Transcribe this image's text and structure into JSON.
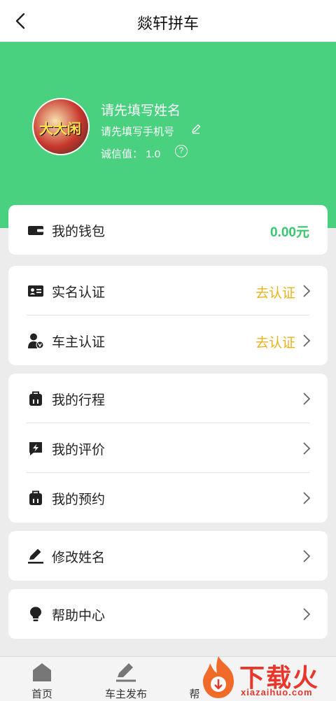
{
  "header": {
    "title": "燚轩拼车",
    "back_icon": "back-chevron-icon"
  },
  "profile": {
    "name": "请先填写姓名",
    "phone": "请先填写手机号",
    "credit_label": "诚信值：",
    "credit_value": "1.0",
    "help_glyph": "?",
    "avatar_text": "大大闲"
  },
  "wallet": {
    "label": "我的钱包",
    "amount": "0.00元",
    "icon": "wallet-icon"
  },
  "verify": [
    {
      "label": "实名认证",
      "status": "去认证",
      "icon": "id-card-icon"
    },
    {
      "label": "车主认证",
      "status": "去认证",
      "icon": "driver-verify-icon"
    }
  ],
  "menu": [
    {
      "label": "我的行程",
      "icon": "luggage-icon"
    },
    {
      "label": "我的评价",
      "icon": "lightning-chat-icon"
    },
    {
      "label": "我的预约",
      "icon": "luggage-icon"
    }
  ],
  "edit_name": {
    "label": "修改姓名",
    "icon": "pen-icon"
  },
  "help_center": {
    "label": "帮助中心",
    "icon": "bulb-icon"
  },
  "tabs": [
    {
      "label": "首页",
      "icon": "home-icon"
    },
    {
      "label": "车主发布",
      "icon": "publish-pen-icon"
    },
    {
      "label": "帮",
      "icon": "help-icon"
    }
  ],
  "watermark": {
    "text": "下载火",
    "sub": "xiazaihuo.com"
  },
  "colors": {
    "accent": "#4ad17f",
    "status": "#e9b21c",
    "amount": "#37c76f"
  }
}
